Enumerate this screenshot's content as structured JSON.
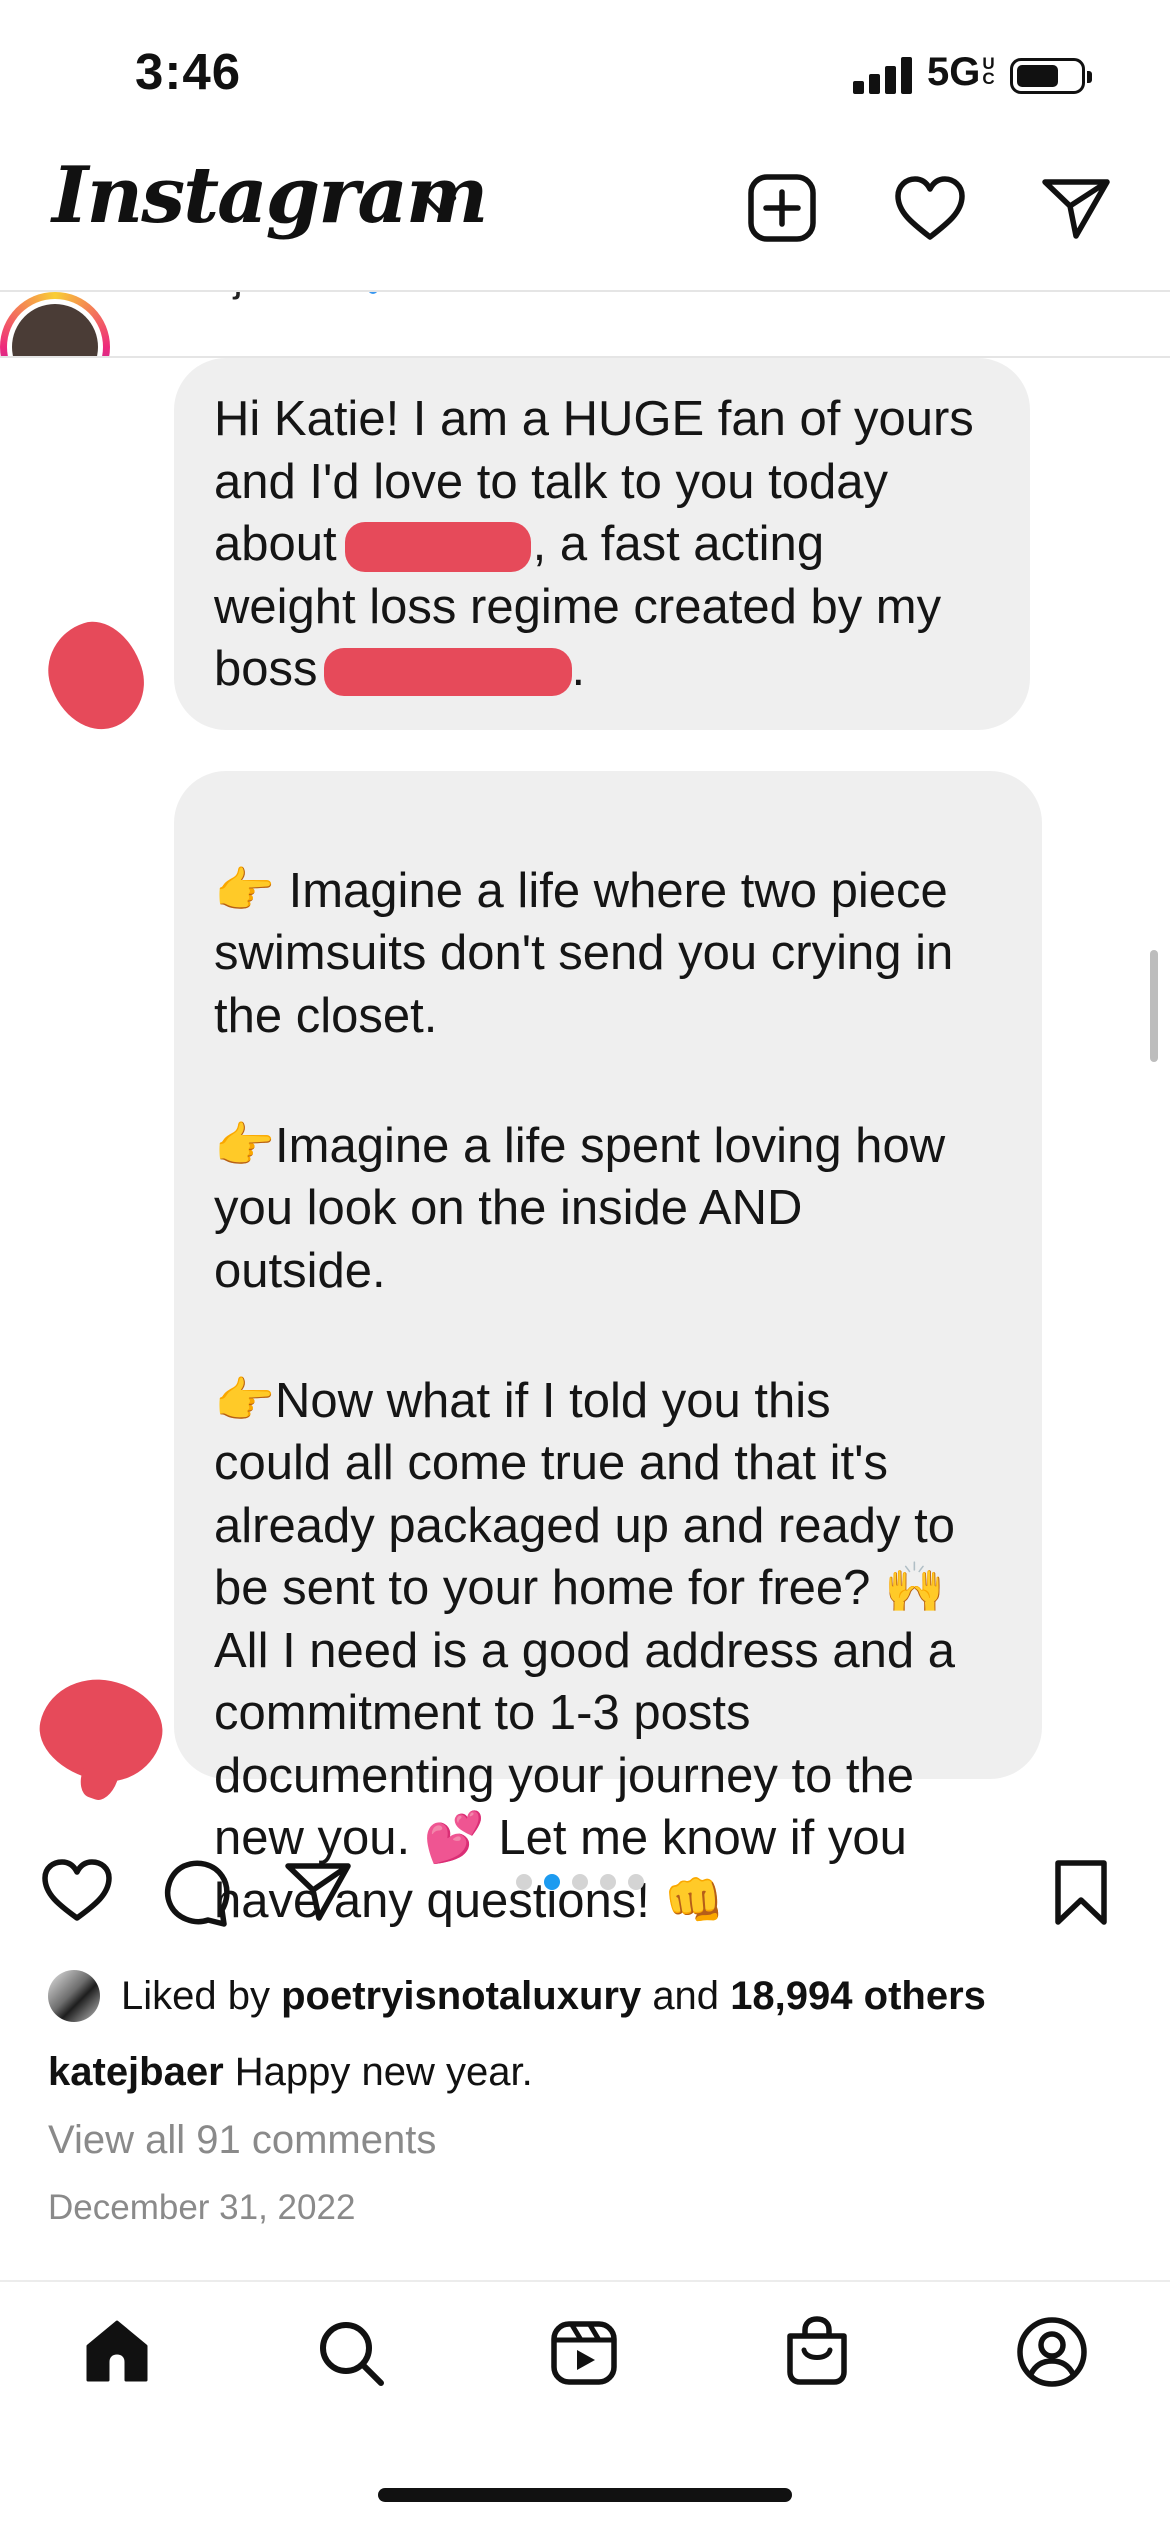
{
  "status_bar": {
    "time": "3:46",
    "network": "5G",
    "network_sub": "UC"
  },
  "header": {
    "logo": "Instagram",
    "icons": [
      "chevron-down-icon",
      "new-post-icon",
      "activity-heart-icon",
      "direct-message-icon"
    ]
  },
  "story": {
    "username": "katejbaer"
  },
  "messages": [
    {
      "paragraphs": [
        "Hi Katie! I am a HUGE fan of yours and I'd love to talk to you today about [redacted], a fast acting weight loss regime created by my boss [redacted]."
      ],
      "lines": [
        "Hi Katie! I am a HUGE fan of yours",
        "and I'd love to talk to you today",
        ", a fast acting",
        "weight loss regime created by my",
        "."
      ],
      "line3_start": "about",
      "line5_start": "boss"
    },
    {
      "paragraphs": [
        "👉 Imagine a life where two piece\nswimsuits don't send you crying in\nthe closet.",
        "👉Imagine a life spent loving how\nyou look on the inside AND\noutside.",
        "👉Now what if I told you this\ncould all come true and that it's\nalready packaged up and ready to\nbe sent to your home for free? 🙌\nAll I need is a good address and a\ncommitment to 1-3 posts\ndocumenting your journey to the\nnew you. 💕 Let me know if you\nhave any questions! 👊"
      ]
    }
  ],
  "post": {
    "carousel": {
      "total": 5,
      "active": 2
    },
    "liked_by_prefix": "Liked by",
    "liked_by_user": "poetryisnotaluxury",
    "liked_by_and": "and",
    "liked_by_count": "18,994 others",
    "caption_user": "katejbaer",
    "caption_text": "Happy new year.",
    "view_comments": "View all 91 comments",
    "date": "December 31, 2022"
  },
  "actions": [
    "like-heart-icon",
    "comment-icon",
    "share-icon",
    "bookmark-icon"
  ],
  "tab_bar": [
    "home-icon",
    "search-icon",
    "reels-icon",
    "shop-icon",
    "profile-icon"
  ],
  "colors": {
    "bubble_bg": "#efefef",
    "redaction": "#e64a5a",
    "carousel_active": "#1d9bf0"
  }
}
